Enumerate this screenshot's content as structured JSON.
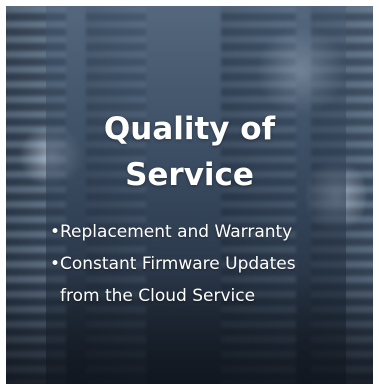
{
  "card": {
    "title_line1": "Quality of",
    "title_line2": "Service",
    "bullets": [
      {
        "lines": [
          "Replacement and Warranty"
        ]
      },
      {
        "lines": [
          "Constant Firmware Updates",
          "from the Cloud Service"
        ]
      }
    ]
  },
  "background": {
    "subject": "blurred server racks in a data center",
    "icon": "none"
  },
  "colors": {
    "text": "#ffffff",
    "overlay": "#4a5d73",
    "page_background": "#ffffff"
  }
}
